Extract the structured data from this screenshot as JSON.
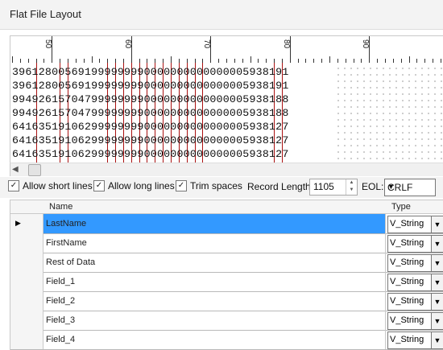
{
  "window": {
    "title": "Flat File Layout"
  },
  "ruler": {
    "labels": [
      "50",
      "60",
      "70",
      "80",
      "90"
    ]
  },
  "viewer": {
    "rows": [
      "396128005691999999990000000000000005938191",
      "396128005691999999990000000000000005938191",
      "994926157047999999990000000000000005938188",
      "994926157047999999990000000000000005938188",
      "641635191062999999990000000000000005938127",
      "641635191062999999990000000000000005938127",
      "641635191062999999990000000000000005938127"
    ]
  },
  "options": {
    "allow_short_lines": {
      "label": "Allow short lines",
      "checked": true
    },
    "allow_long_lines": {
      "label": "Allow long lines",
      "checked": true
    },
    "trim_spaces": {
      "label": "Trim spaces",
      "checked": true
    },
    "record_length_label": "Record Length:",
    "record_length_value": "1105",
    "eol_label": "EOL:",
    "eol_value": "CRLF"
  },
  "grid": {
    "columns": [
      "Name",
      "Type"
    ],
    "rows": [
      {
        "name": "LastName",
        "type": "V_String",
        "current": true
      },
      {
        "name": "FirstName",
        "type": "V_String"
      },
      {
        "name": "Rest of Data",
        "type": "V_String"
      },
      {
        "name": "Field_1",
        "type": "V_String"
      },
      {
        "name": "Field_2",
        "type": "V_String"
      },
      {
        "name": "Field_3",
        "type": "V_String"
      },
      {
        "name": "Field_4",
        "type": "V_String"
      }
    ]
  },
  "colors": {
    "selection": "#3399ff",
    "column_marker": "#aa1111"
  }
}
